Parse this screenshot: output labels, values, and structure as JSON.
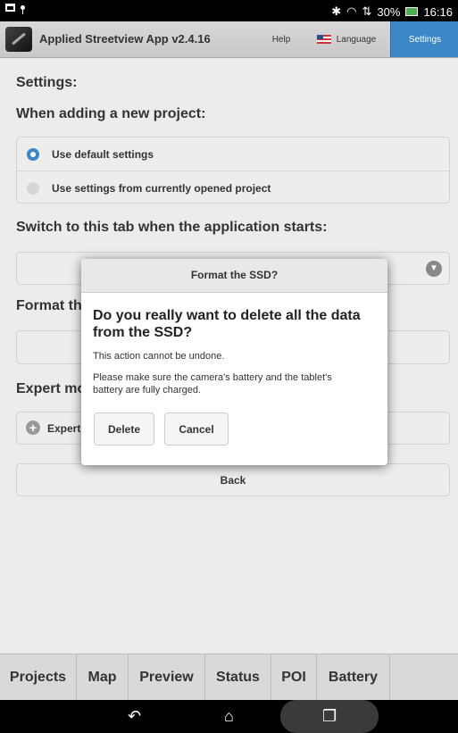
{
  "status_bar": {
    "battery_pct": "30%",
    "time": "16:16",
    "icons": [
      "screenshot-icon",
      "location-pin-icon",
      "bluetooth-icon",
      "wifi-icon",
      "data-arrows-icon",
      "battery-icon"
    ]
  },
  "header": {
    "title": "Applied Streetview App v2.4.16",
    "help": "Help",
    "language": "Language",
    "settings": "Settings",
    "accent": "#3b87c7"
  },
  "main": {
    "heading": "Settings:",
    "new_project_label": "When adding a new project:",
    "opt_default": "Use default settings",
    "opt_current": "Use settings from currently opened project",
    "startup_tab_label": "Switch to this tab when the application starts:",
    "format_label": "Format th",
    "expert_label": "Expert mo",
    "expert_button": "Expert",
    "back": "Back"
  },
  "dialog": {
    "title": "Format the SSD?",
    "question": "Do you really want to delete all the data from the SSD?",
    "text1": "This action cannot be undone.",
    "text2": "Please make sure the camera's battery and the tablet's battery are fully charged.",
    "delete": "Delete",
    "cancel": "Cancel"
  },
  "tabs": [
    "Projects",
    "Map",
    "Preview",
    "Status",
    "POI",
    "Battery"
  ],
  "nav": {
    "back_glyph": "↶",
    "home_glyph": "⌂",
    "recents_glyph": "❐"
  }
}
